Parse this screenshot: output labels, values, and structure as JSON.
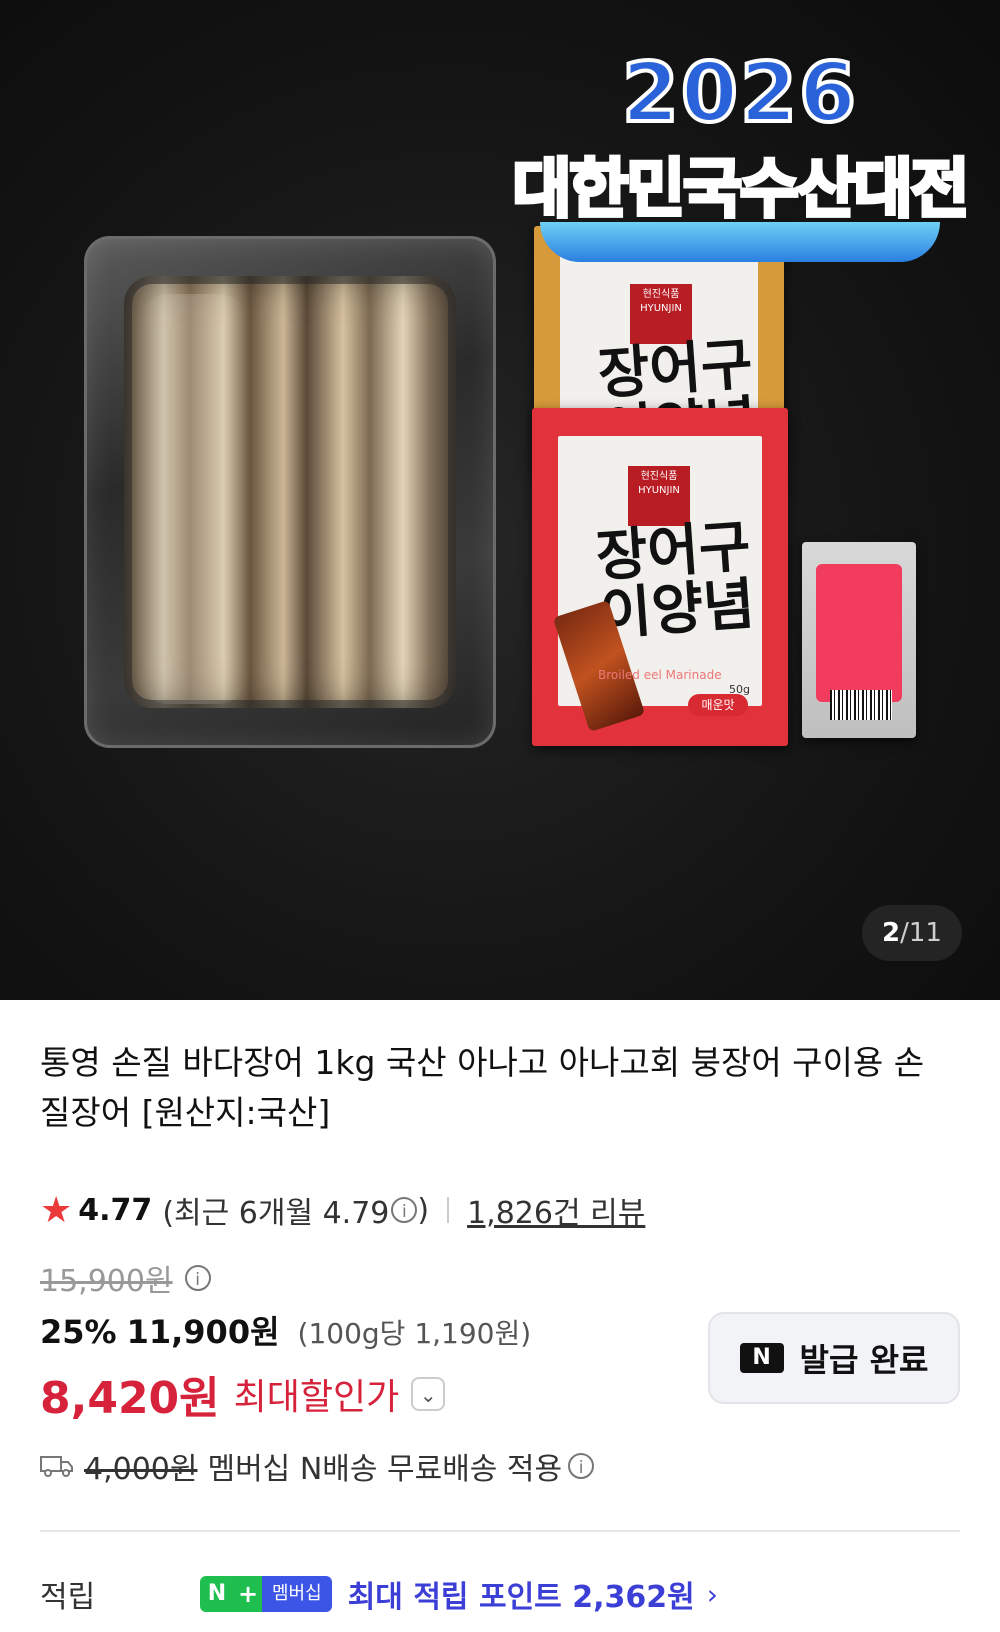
{
  "gallery": {
    "festival_year": "2026",
    "festival_name": "대한민국수산대전",
    "current": "2",
    "total": "11",
    "packet_brand": "현진식품 HYUNJIN",
    "packet_big_text": "장어구이양념",
    "packet_english": "Broiled eel Marinade",
    "packet_spicy": "매운맛",
    "packet_weight": "50g"
  },
  "product": {
    "title": "통영 손질 바다장어 1kg 국산 아나고 아나고회 붕장어 구이용 손질장어 [원산지:국산]"
  },
  "rating": {
    "score": "4.77",
    "recent_prefix": "(최근 6개월 4.79",
    "recent_suffix": ")",
    "reviews": "1,826건 리뷰"
  },
  "price": {
    "original": "15,900원",
    "discount": "25%",
    "sale": "11,900원",
    "unit_price": "(100g당 1,190원)",
    "best_price": "8,420원",
    "best_label": "최대할인가"
  },
  "coupon": {
    "label": "발급 완료",
    "icon": "N"
  },
  "shipping": {
    "original_fee": "4,000원",
    "text": "멤버십 N배송 무료배송 적용"
  },
  "points": {
    "label": "적립",
    "badge_n": "N",
    "badge_plus": "+",
    "badge_membership": "멤버십",
    "max_text": "최대 적립 포인트 2,362원"
  },
  "colors": {
    "accent_red": "#d6223a",
    "star": "#ea3a3a",
    "points_blue": "#3c3fd6",
    "npay_green": "#1fbf4f"
  }
}
